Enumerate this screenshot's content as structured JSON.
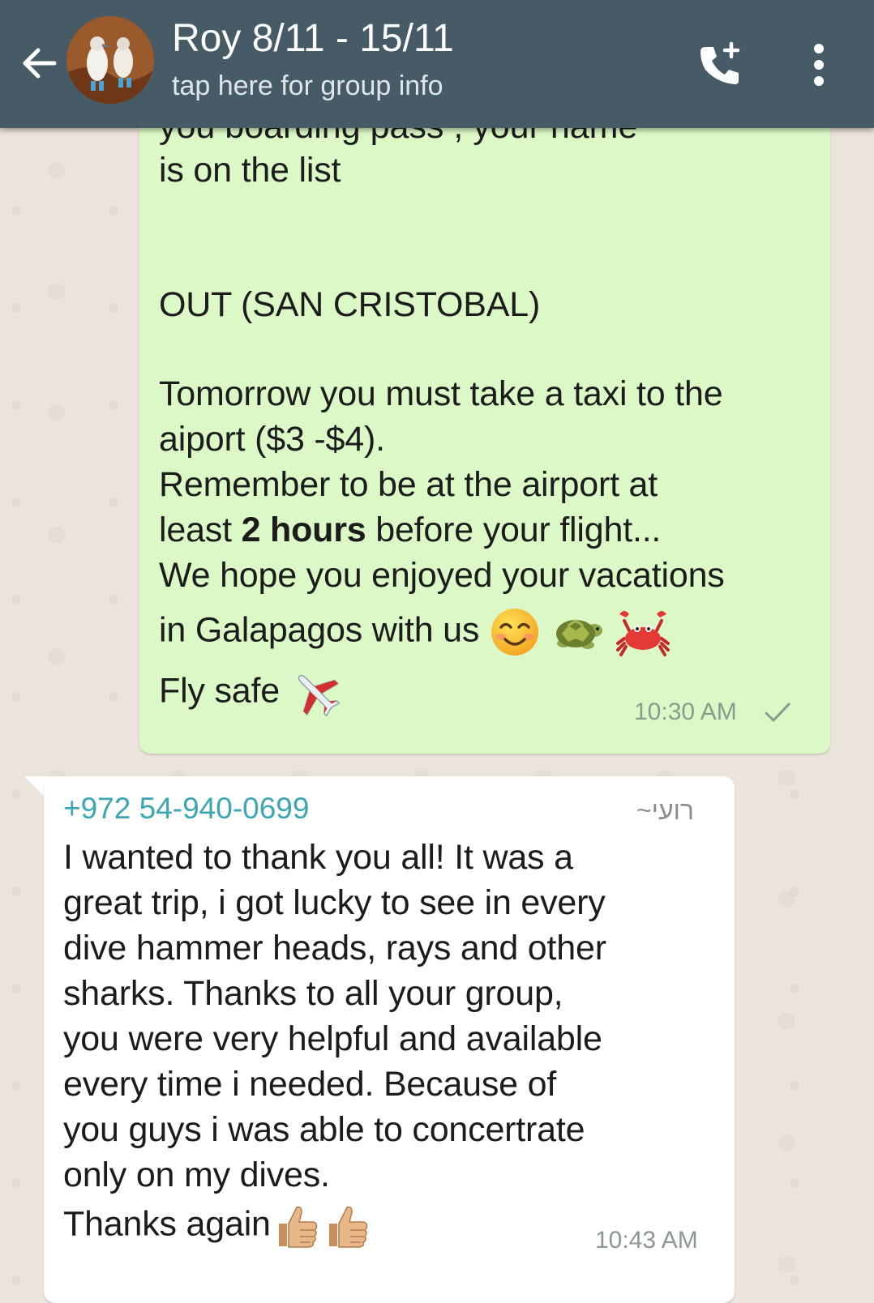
{
  "header": {
    "title": "Roy 8/11 - 15/11",
    "subtitle": "tap here for group info",
    "colors": {
      "bar": "#465b65",
      "text": "#ffffff"
    }
  },
  "messages": {
    "outgoing": {
      "clipped_line": "you boarding pass , your name",
      "line1": "is on the list",
      "heading": "OUT (SAN CRISTOBAL)",
      "p1": "Tomorrow you must take a taxi to the",
      "p2": "aiport ($3 -$4).",
      "p3": "Remember to be at the airport at",
      "p4_pre": "least ",
      "p4_bold": "2 hours",
      "p4_post": " before your flight...",
      "p5": "We hope you enjoyed your vacations",
      "p6": "in Galapagos with us",
      "emojis": [
        "smiling-face-icon",
        "turtle-icon",
        "crab-icon"
      ],
      "p7": "Fly safe",
      "p7_emoji": "airplane-icon",
      "time": "10:30 AM",
      "status": "sent",
      "bubble_color": "#dcf8c6"
    },
    "incoming": {
      "sender_phone": "+972 54-940-0699",
      "sender_name": "~רועי",
      "lines": [
        "I wanted to thank you all! It was a",
        "great trip, i got lucky to see in every",
        "dive hammer heads, rays and other",
        "sharks. Thanks to all your group,",
        "you were very helpful and available",
        "every time i needed. Because of",
        "you guys i was able to concertrate",
        "only on my dives."
      ],
      "last_line": "Thanks again",
      "last_emoji": "thumbs-up-icon",
      "time": "10:43 AM",
      "sender_color": "#3ca6b3",
      "bubble_color": "#ffffff"
    }
  }
}
